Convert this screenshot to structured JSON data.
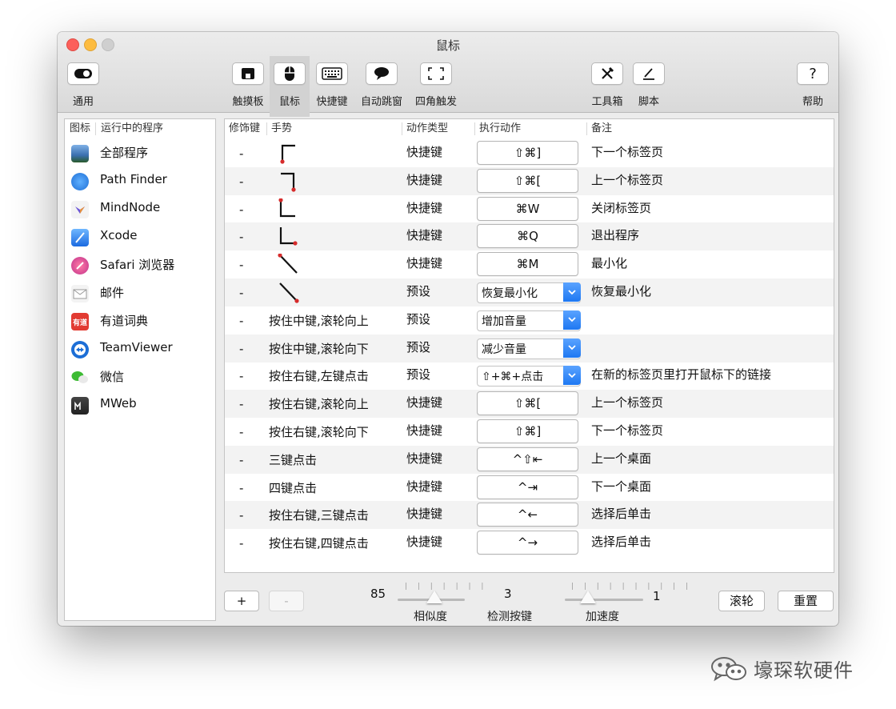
{
  "window": {
    "title": "鼠标"
  },
  "toolbar": {
    "general": "通用",
    "trackpad": "触摸板",
    "mouse": "鼠标",
    "shortcut": "快捷键",
    "auto_popup": "自动跳窗",
    "corner": "四角触发",
    "toolbox": "工具箱",
    "script": "脚本",
    "help": "帮助"
  },
  "sidebar": {
    "col_icon": "图标",
    "col_app": "运行中的程序",
    "apps": [
      {
        "name": "全部程序",
        "icon": "all-apps-icon"
      },
      {
        "name": "Path Finder",
        "icon": "path-finder-icon"
      },
      {
        "name": "MindNode",
        "icon": "mindnode-icon"
      },
      {
        "name": "Xcode",
        "icon": "xcode-icon"
      },
      {
        "name": "Safari 浏览器",
        "icon": "safari-icon"
      },
      {
        "name": "邮件",
        "icon": "mail-icon"
      },
      {
        "name": "有道词典",
        "icon": "youdao-icon",
        "icon_text": "有道"
      },
      {
        "name": "TeamViewer",
        "icon": "teamviewer-icon"
      },
      {
        "name": "微信",
        "icon": "wechat-icon"
      },
      {
        "name": "MWeb",
        "icon": "mweb-icon"
      }
    ]
  },
  "table": {
    "headers": {
      "modifier": "修饰键",
      "gesture": "手势",
      "type": "动作类型",
      "action": "执行动作",
      "note": "备注"
    },
    "rows": [
      {
        "modifier": "-",
        "gesture": "",
        "gesture_shape": "right-down",
        "type": "快捷键",
        "action": "⇧⌘]",
        "action_kind": "button",
        "note": "下一个标签页"
      },
      {
        "modifier": "-",
        "gesture": "",
        "gesture_shape": "left-down",
        "type": "快捷键",
        "action": "⇧⌘[",
        "action_kind": "button",
        "note": "上一个标签页"
      },
      {
        "modifier": "-",
        "gesture": "",
        "gesture_shape": "down-right",
        "type": "快捷键",
        "action": "⌘W",
        "action_kind": "button",
        "note": "关闭标签页"
      },
      {
        "modifier": "-",
        "gesture": "",
        "gesture_shape": "down-right-2",
        "type": "快捷键",
        "action": "⌘Q",
        "action_kind": "button",
        "note": "退出程序"
      },
      {
        "modifier": "-",
        "gesture": "",
        "gesture_shape": "diag-up",
        "type": "快捷键",
        "action": "⌘M",
        "action_kind": "button",
        "note": "最小化"
      },
      {
        "modifier": "-",
        "gesture": "",
        "gesture_shape": "diag-down",
        "type": "预设",
        "action": "恢复最小化",
        "action_kind": "select",
        "note": "恢复最小化"
      },
      {
        "modifier": "-",
        "gesture": "按住中键,滚轮向上",
        "type": "预设",
        "action": "增加音量",
        "action_kind": "select",
        "note": ""
      },
      {
        "modifier": "-",
        "gesture": "按住中键,滚轮向下",
        "type": "预设",
        "action": "减少音量",
        "action_kind": "select",
        "note": ""
      },
      {
        "modifier": "-",
        "gesture": "按住右键,左键点击",
        "type": "预设",
        "action": "⇧+⌘+点击",
        "action_kind": "select",
        "note": "在新的标签页里打开鼠标下的链接"
      },
      {
        "modifier": "-",
        "gesture": "按住右键,滚轮向上",
        "type": "快捷键",
        "action": "⇧⌘[",
        "action_kind": "button",
        "note": "上一个标签页"
      },
      {
        "modifier": "-",
        "gesture": "按住右键,滚轮向下",
        "type": "快捷键",
        "action": "⇧⌘]",
        "action_kind": "button",
        "note": "下一个标签页"
      },
      {
        "modifier": "-",
        "gesture": "三键点击",
        "type": "快捷键",
        "action": "^⇧⇤",
        "action_kind": "button",
        "note": "上一个桌面"
      },
      {
        "modifier": "-",
        "gesture": "四键点击",
        "type": "快捷键",
        "action": "^⇥",
        "action_kind": "button",
        "note": "下一个桌面"
      },
      {
        "modifier": "-",
        "gesture": "按住右键,三键点击",
        "type": "快捷键",
        "action": "^←",
        "action_kind": "button",
        "note": "选择后单击"
      },
      {
        "modifier": "-",
        "gesture": "按住右键,四键点击",
        "type": "快捷键",
        "action": "^→",
        "action_kind": "button",
        "note": "选择后单击"
      }
    ]
  },
  "footer": {
    "add_label": "+",
    "remove_label": "-",
    "similarity_value": "85",
    "similarity_label": "相似度",
    "similarity_level": 0.55,
    "buttons_value": "3",
    "buttons_label": "检测按键",
    "accel_value": "1",
    "accel_label": "加速度",
    "accel_level": 0.3,
    "scroll_label": "滚轮",
    "reset_label": "重置"
  },
  "watermark": {
    "text": "壕琛软硬件"
  },
  "colors": {
    "accent": "#1e78f2",
    "gesture_dot": "#d62b2b",
    "close": "#fc605b",
    "minimize": "#fdbc40"
  }
}
